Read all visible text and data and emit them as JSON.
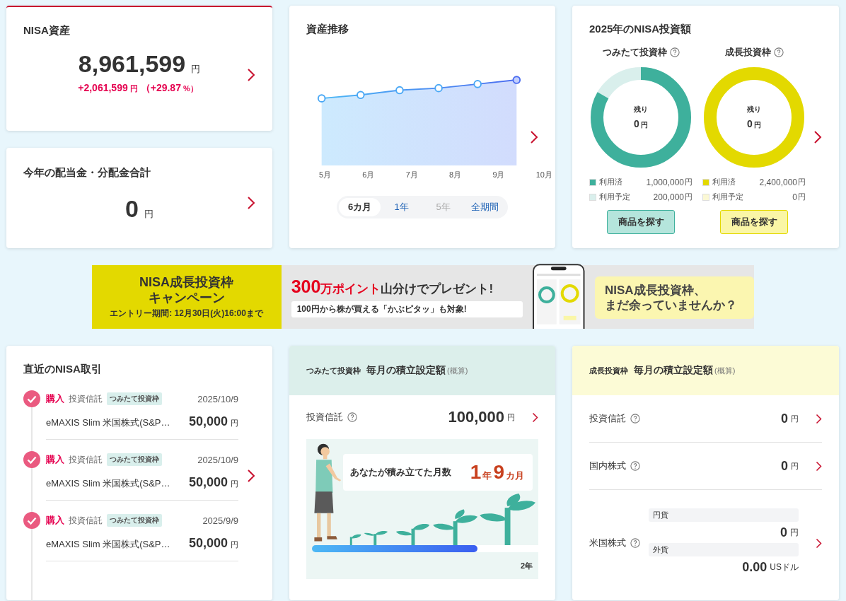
{
  "nisa_assets": {
    "title": "NISA資産",
    "amount": "8,961,599",
    "unit": "円",
    "change": "+2,061,599",
    "change_unit": "円",
    "change_pct_open": "（+29.87",
    "pct_unit": "%）"
  },
  "dividends": {
    "title": "今年の配当金・分配金合計",
    "amount": "0",
    "unit": "円"
  },
  "asset_trend": {
    "title": "資産推移",
    "months": [
      "5月",
      "6月",
      "7月",
      "8月",
      "9月",
      "10月"
    ],
    "periods": [
      {
        "label": "6カ月",
        "selected": true,
        "disabled": false
      },
      {
        "label": "1年",
        "selected": false,
        "disabled": false
      },
      {
        "label": "5年",
        "selected": false,
        "disabled": true
      },
      {
        "label": "全期間",
        "selected": false,
        "disabled": false
      }
    ]
  },
  "investment_2025": {
    "title": "2025年のNISA投資額",
    "frames": [
      {
        "kind": "tsumitate",
        "name": "つみたて投資枠",
        "level": 0.833,
        "remaining_label": "残り",
        "remaining": "0",
        "unit": "円",
        "legend": [
          {
            "label": "利用済",
            "value": "1,000,000",
            "unit": "円",
            "color": "#3eb09c"
          },
          {
            "label": "利用予定",
            "value": "200,000",
            "unit": "円",
            "color": "#d9efec"
          }
        ],
        "button": "商品を探す"
      },
      {
        "kind": "growth",
        "name": "成長投資枠",
        "level": 1,
        "remaining_label": "残り",
        "remaining": "0",
        "unit": "円",
        "legend": [
          {
            "label": "利用済",
            "value": "2,400,000",
            "unit": "円",
            "color": "#e3d900"
          },
          {
            "label": "利用予定",
            "value": "0",
            "unit": "円",
            "color": "#fbf8d4"
          }
        ],
        "button": "商品を探す"
      }
    ]
  },
  "banner": {
    "title_lines": [
      "NISA成長投資枠",
      "キャンペーン"
    ],
    "entry": "エントリー期間: 12月30日(火)16:00まで",
    "headline": [
      {
        "text": "300",
        "kind": "big"
      },
      {
        "text": "万ポイント",
        "kind": "red"
      },
      {
        "text": "山分けでプレゼント!",
        "kind": "plain"
      }
    ],
    "sub": "100円から株が買える「かぶピタッ」も対象!",
    "bubble_lines": [
      "NISA成長投資枠、",
      "まだ余っていませんか？"
    ]
  },
  "recent_trades": {
    "title": "直近のNISA取引",
    "trades": [
      {
        "type": "購入",
        "product": "投資信託",
        "tag": "つみたて投資枠",
        "date": "2025/10/9",
        "name": "eMAXIS Slim 米国株式(S&P…",
        "amount": "50,000",
        "unit": "円"
      },
      {
        "type": "購入",
        "product": "投資信託",
        "tag": "つみたて投資枠",
        "date": "2025/10/9",
        "name": "eMAXIS Slim 米国株式(S&P…",
        "amount": "50,000",
        "unit": "円"
      },
      {
        "type": "購入",
        "product": "投資信託",
        "tag": "つみたて投資枠",
        "date": "2025/9/9",
        "name": "eMAXIS Slim 米国株式(S&P…",
        "amount": "50,000",
        "unit": "円"
      }
    ]
  },
  "tsumitate_monthly": {
    "frame": "つみたて投資枠",
    "title": "毎月の積立設定額",
    "note": "(概算)",
    "row": {
      "label": "投資信託",
      "amount": "100,000",
      "unit": "円"
    },
    "months_label": "あなたが積み立てた月数",
    "months": [
      {
        "text": "1",
        "kind": "number"
      },
      {
        "text": "年",
        "kind": "unit"
      },
      {
        "text": "9",
        "kind": "number"
      },
      {
        "text": "カ月",
        "kind": "unit"
      }
    ],
    "level": 0.73,
    "goal": "2年"
  },
  "growth_monthly": {
    "frame": "成長投資枠",
    "title": "毎月の積立設定額",
    "note": "(概算)",
    "rows": [
      {
        "label": "投資信託",
        "amount": "0",
        "unit": "円"
      },
      {
        "label": "国内株式",
        "amount": "0",
        "unit": "円"
      },
      {
        "label": "米国株式",
        "sub": [
          {
            "label": "円貨",
            "amount": "0",
            "unit": "円"
          },
          {
            "label": "外貨",
            "amount": "0.00",
            "unit": "USドル"
          }
        ]
      }
    ]
  }
}
